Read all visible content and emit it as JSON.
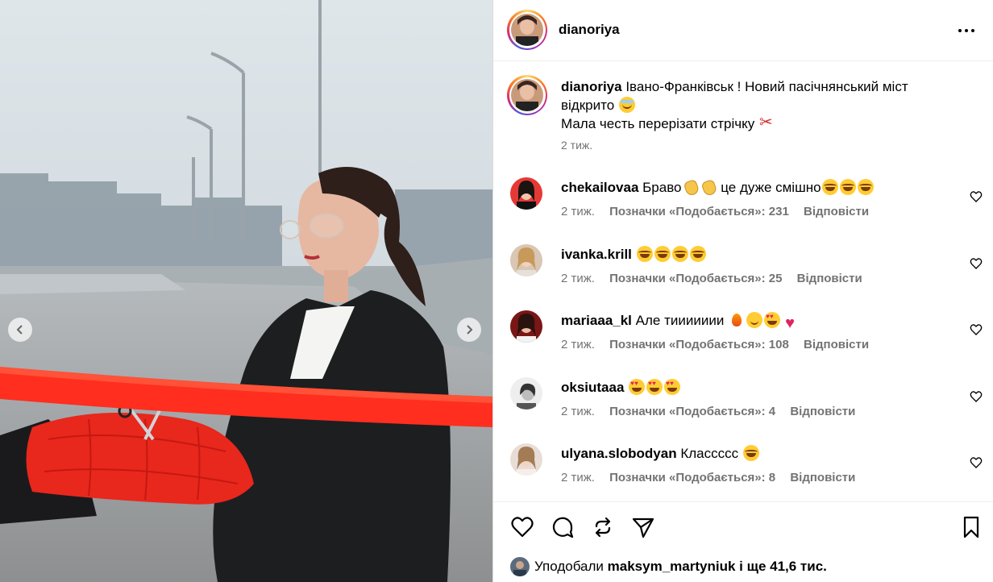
{
  "post": {
    "author": "dianoriya",
    "caption_line1": "Івано-Франківськ ! Новий пасічнянський міст",
    "caption_line2": "відкрито",
    "caption_line3": "Мала честь перерізати стрічку",
    "time": "2 тиж."
  },
  "comments": [
    {
      "user": "chekailovaa",
      "text_a": "Браво",
      "text_b": " це дуже смішно",
      "time": "2 тиж.",
      "likes": "Позначки «Подобається»: 231",
      "reply": "Відповісти"
    },
    {
      "user": "ivanka.krill",
      "text_a": "",
      "text_b": "",
      "time": "2 тиж.",
      "likes": "Позначки «Подобається»: 25",
      "reply": "Відповісти"
    },
    {
      "user": "mariaaa_kl",
      "text_a": "Але тиииииии",
      "text_b": "",
      "time": "2 тиж.",
      "likes": "Позначки «Подобається»: 108",
      "reply": "Відповісти"
    },
    {
      "user": "oksiutaaa",
      "text_a": "",
      "text_b": "",
      "time": "2 тиж.",
      "likes": "Позначки «Подобається»: 4",
      "reply": "Відповісти"
    },
    {
      "user": "ulyana.slobodyan",
      "text_a": "Классссс",
      "text_b": "",
      "time": "2 тиж.",
      "likes": "Позначки «Подобається»: 8",
      "reply": "Відповісти"
    }
  ],
  "footer": {
    "liked_by_prefix": "Уподобали",
    "liked_by_user": "maksym_martyniuk",
    "liked_by_suffix": "і ще 41,6 тис."
  },
  "icons": {
    "like": "heart-icon",
    "comment": "comment-icon",
    "repost": "repost-icon",
    "share": "send-icon",
    "save": "bookmark-icon",
    "more": "more-options-icon",
    "prev": "chevron-left-icon",
    "next": "chevron-right-icon"
  },
  "colors": {
    "ribbon": "#ff2e1f",
    "muted_text": "#737373",
    "story_ring": "#d62976"
  }
}
